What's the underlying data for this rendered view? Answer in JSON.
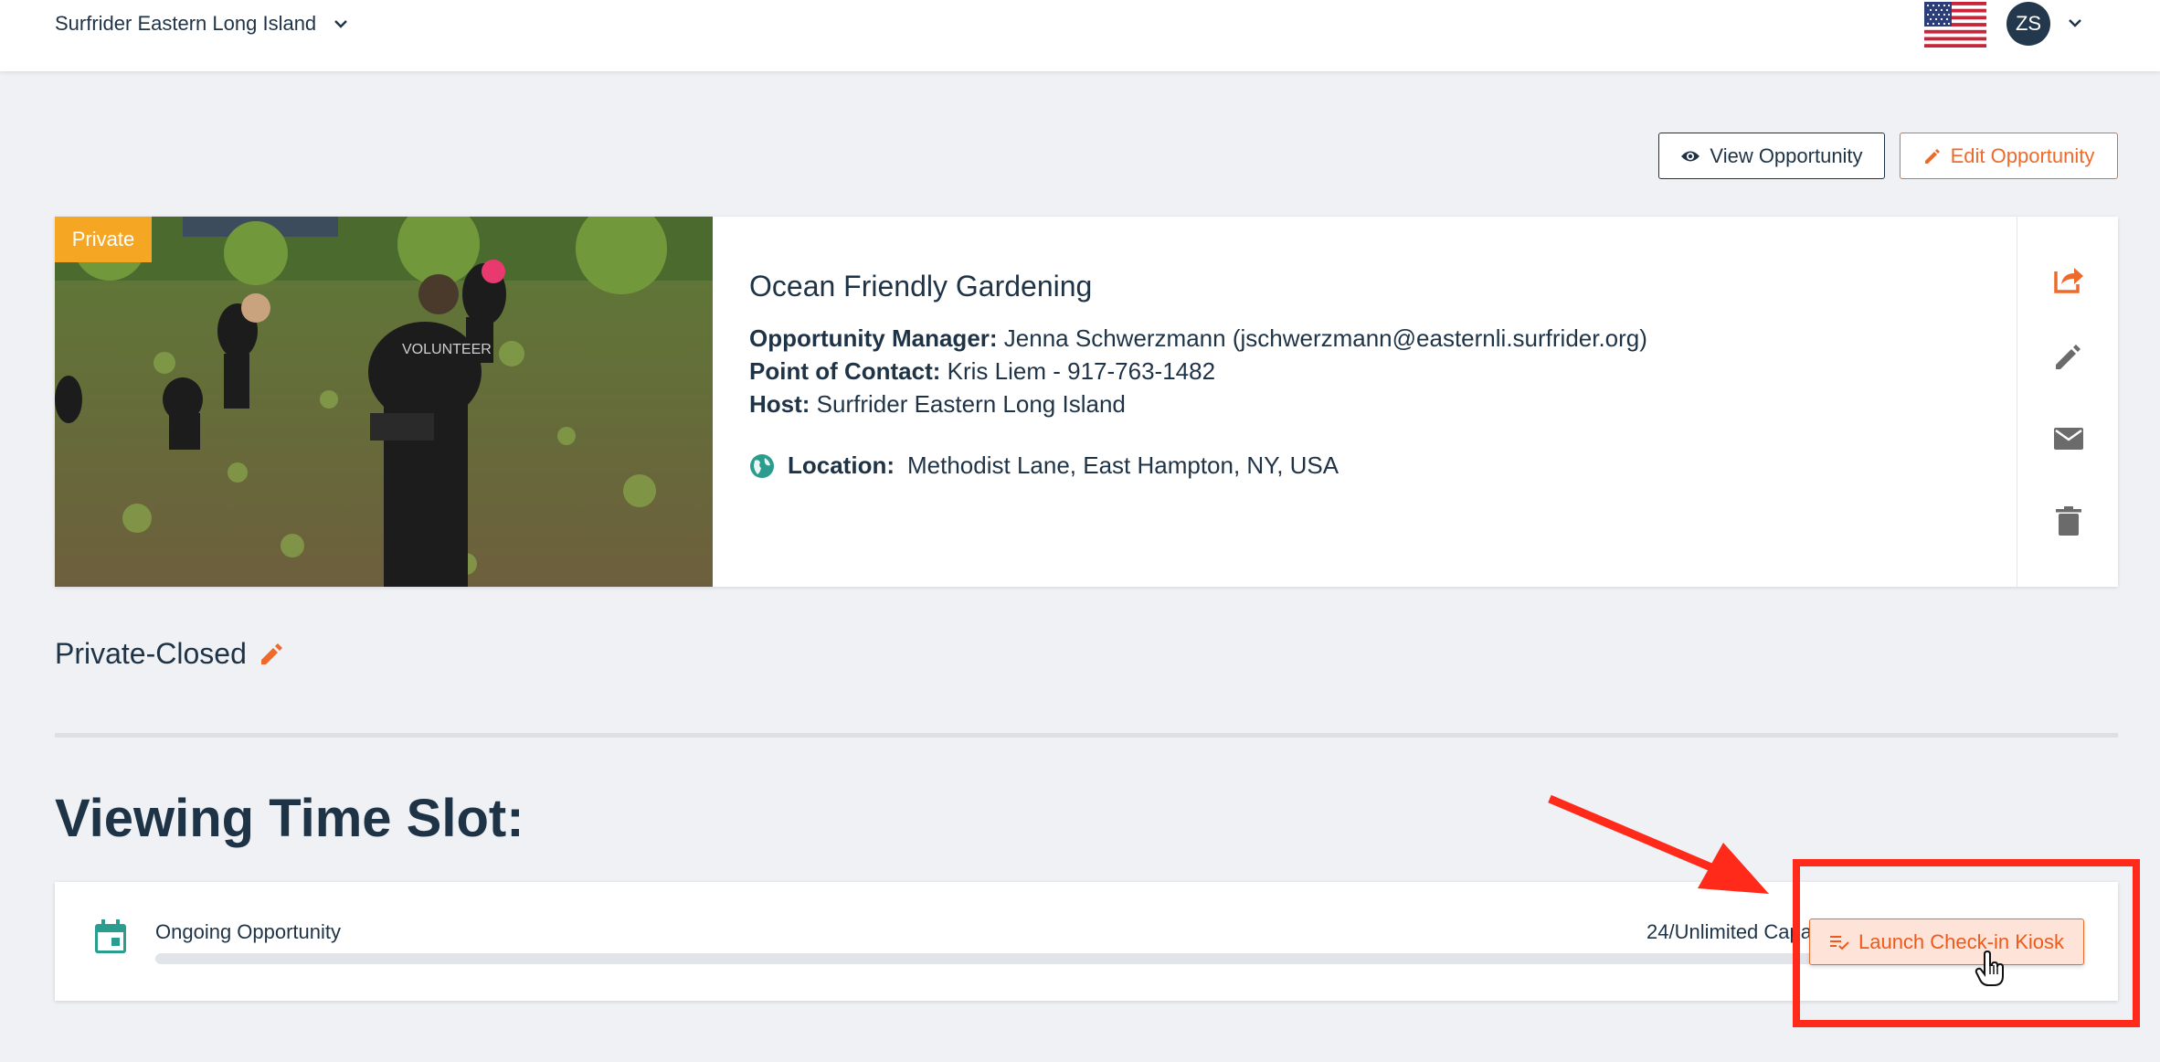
{
  "topbar": {
    "org_name": "Surfrider Eastern Long Island",
    "user_initials": "ZS"
  },
  "actions": {
    "view_label": "View Opportunity",
    "edit_label": "Edit Opportunity"
  },
  "opportunity": {
    "visibility_tag": "Private",
    "title": "Ocean Friendly Gardening",
    "manager_label": "Opportunity Manager:",
    "manager_value": "Jenna Schwerzmann (jschwerzmann@easternli.surfrider.org)",
    "contact_label": "Point of Contact:",
    "contact_value": "Kris Liem - 917-763-1482",
    "host_label": "Host:",
    "host_value": "Surfrider Eastern Long Island",
    "location_label": "Location:",
    "location_value": "Methodist Lane, East Hampton, NY, USA"
  },
  "status": {
    "label": "Private-Closed"
  },
  "time_slot": {
    "heading": "Viewing Time Slot:",
    "name": "Ongoing Opportunity",
    "capacity": "24/Unlimited Capacity",
    "kiosk_label": "Launch Check-in Kiosk",
    "fill_fraction": 0
  },
  "colors": {
    "accent": "#ee6a2c",
    "navy": "#1f3346",
    "teal": "#2a9d8f",
    "private_tag": "#f5a623",
    "annotation_red": "#ff2a1a"
  }
}
